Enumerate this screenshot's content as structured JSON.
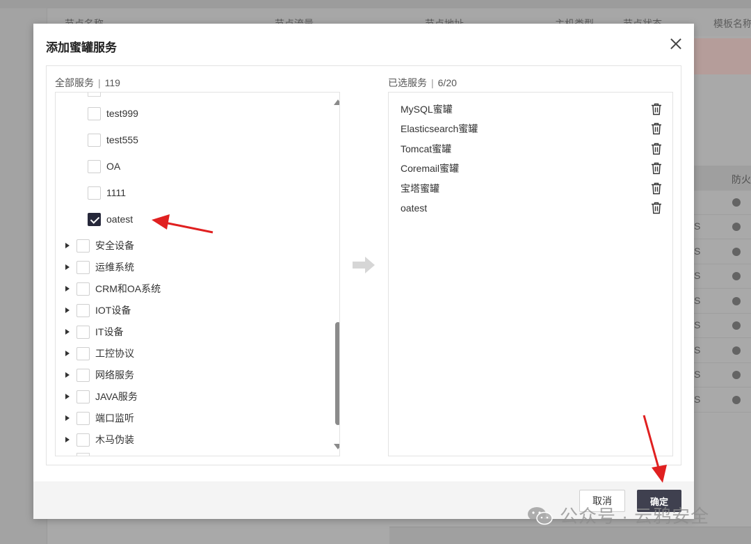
{
  "background": {
    "table_headers": [
      "节点名称",
      "节点流量",
      "节点地址",
      "主机类型",
      "节点状态",
      "模板名称"
    ],
    "right_header": "防火",
    "row_letter": "S"
  },
  "modal": {
    "title": "添加蜜罐服务",
    "left_panel": {
      "title": "全部服务",
      "count": "119",
      "leaf_items": [
        {
          "label": "test999",
          "checked": false
        },
        {
          "label": "test555",
          "checked": false
        },
        {
          "label": "OA",
          "checked": false
        },
        {
          "label": "1111",
          "checked": false
        },
        {
          "label": "oatest",
          "checked": true
        }
      ],
      "groups": [
        {
          "label": "安全设备",
          "checked": false
        },
        {
          "label": "运维系统",
          "checked": false
        },
        {
          "label": "CRM和OA系统",
          "checked": false
        },
        {
          "label": "IOT设备",
          "checked": false
        },
        {
          "label": "IT设备",
          "checked": false
        },
        {
          "label": "工控协议",
          "checked": false
        },
        {
          "label": "网络服务",
          "checked": false
        },
        {
          "label": "JAVA服务",
          "checked": false
        },
        {
          "label": "端口监听",
          "checked": false
        },
        {
          "label": "木马伪装",
          "checked": false
        }
      ]
    },
    "right_panel": {
      "title": "已选服务",
      "count": "6/20",
      "items": [
        "MySQL蜜罐",
        "Elasticsearch蜜罐",
        "Tomcat蜜罐",
        "Coremail蜜罐",
        "宝塔蜜罐",
        "oatest"
      ]
    },
    "cancel_label": "取消",
    "ok_label": "确定"
  },
  "watermark": "公众号 · 云鸦安全",
  "colors": {
    "primary_button": "#3f404f",
    "checkbox_checked": "#26283a",
    "annotation_arrow": "#e02020"
  }
}
